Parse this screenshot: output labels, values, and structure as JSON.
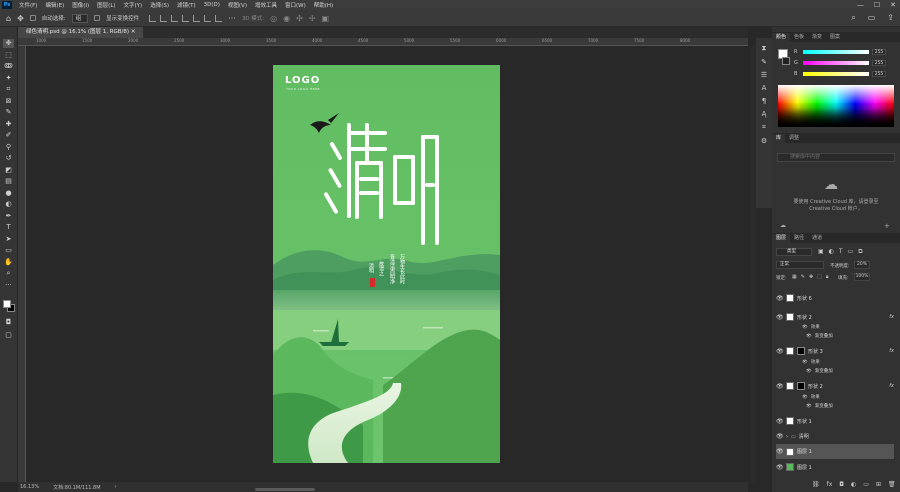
{
  "menubar": {
    "app_icon": "Ps",
    "items": [
      "文件(F)",
      "编辑(E)",
      "图像(I)",
      "图层(L)",
      "文字(Y)",
      "选择(S)",
      "滤镜(T)",
      "3D(D)",
      "视图(V)",
      "增效工具",
      "窗口(W)",
      "帮助(H)"
    ]
  },
  "optionsbar": {
    "auto_select_label": "自动选择:",
    "auto_select_value": "组",
    "show_transform_label": "显示变换控件",
    "mode_3d_label": "3D 模式:"
  },
  "document": {
    "tab_label": "绿色清明.psd @ 16.1% (图层 1, RGB/8)",
    "zoom": "16.13%",
    "doc_info": "文档:80.1M/111.8M"
  },
  "ruler": {
    "ticks": [
      "1000",
      "1500",
      "2000",
      "2500",
      "3000",
      "3500",
      "4000",
      "4500",
      "5000",
      "5500",
      "6000",
      "6500",
      "7000",
      "7500",
      "8000"
    ]
  },
  "artwork": {
    "logo_text": "LOGO",
    "logo_sub": "YOUR LOGO HERE",
    "poem_right": [
      "万物生长此时",
      "皆清洁而明净"
    ],
    "poem_left": [
      "故谓之",
      "清明"
    ],
    "seal_color": "#d62b2b",
    "title_color": "#ffffff",
    "bg_color": "#5cb85c"
  },
  "color_panel": {
    "tabs": [
      "颜色",
      "色板",
      "渐变",
      "图案"
    ],
    "channels": [
      {
        "name": "R",
        "value": "255"
      },
      {
        "name": "G",
        "value": "255"
      },
      {
        "name": "B",
        "value": "255"
      }
    ]
  },
  "library_panel": {
    "tabs": [
      "库",
      "调整"
    ],
    "search_placeholder": "搜索库中内容",
    "cc_message": "要使用 Creative Cloud 库，请登录至 Creative Cloud 帐户。"
  },
  "layers_panel": {
    "tabs": [
      "图层",
      "路径",
      "通道"
    ],
    "kind_label": "类型",
    "blend_mode": "正常",
    "opacity_label": "不透明度:",
    "opacity_value": "20%",
    "lock_label": "锁定:",
    "fill_label": "填充:",
    "fill_value": "100%",
    "layers": [
      {
        "name": "形状 6",
        "fx": false,
        "mask": false
      },
      {
        "name": "形状 2",
        "fx": true,
        "mask": false
      },
      {
        "name": "形状 3",
        "fx": true,
        "mask": true
      },
      {
        "name": "形状 2",
        "fx": true,
        "mask": true
      },
      {
        "name": "形状 1",
        "fx": false,
        "mask": false
      },
      {
        "name": "清明",
        "fx": false,
        "mask": false,
        "group": true
      },
      {
        "name": "图层 1",
        "fx": false,
        "mask": false,
        "selected": true
      },
      {
        "name": "图层 1",
        "fx": false,
        "mask": false
      }
    ],
    "effects_label": "效果",
    "overlay_label": "渐变叠加"
  }
}
